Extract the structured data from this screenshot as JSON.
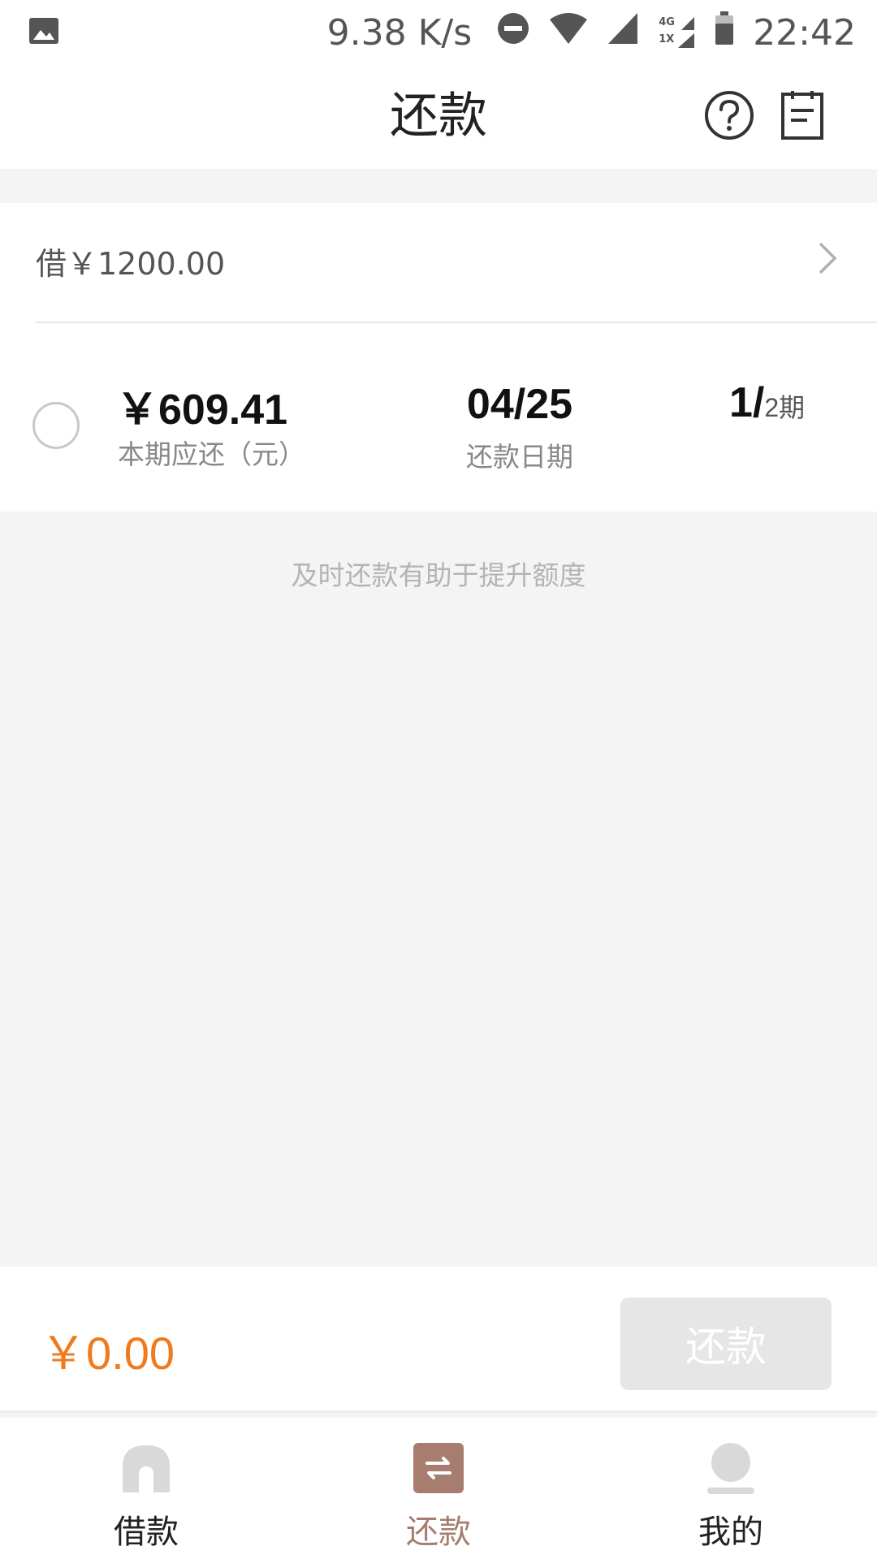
{
  "status_bar": {
    "network_speed": "9.38 K/s",
    "time": "22:42",
    "icons": [
      "gallery-icon",
      "do-not-disturb-icon",
      "wifi-icon",
      "signal-icon",
      "network-4g-icon",
      "battery-icon"
    ],
    "network_4g_label": "4G",
    "network_1x_label": "1X"
  },
  "header": {
    "title": "还款",
    "icons": [
      "help-icon",
      "bill-icon"
    ]
  },
  "loan": {
    "principal": "借￥1200.00"
  },
  "installment": {
    "amount": "￥609.41",
    "amount_label": "本期应还（元）",
    "due_date": "04/25",
    "due_label": "还款日期",
    "term_current": "1/",
    "term_total": "2期",
    "selected": false
  },
  "tip": "及时还款有助于提升额度",
  "payment": {
    "total": "￥0.00",
    "button_label": "还款",
    "button_enabled": false
  },
  "nav": {
    "items": [
      {
        "label": "借款",
        "icon": "home-icon",
        "active": false
      },
      {
        "label": "还款",
        "icon": "repay-icon",
        "active": true
      },
      {
        "label": "我的",
        "icon": "profile-icon",
        "active": false
      }
    ]
  },
  "colors": {
    "accent": "#f07a1c",
    "nav_active": "#a67d6e",
    "disabled_button": "#e6e6e6",
    "background": "#f4f4f4"
  }
}
